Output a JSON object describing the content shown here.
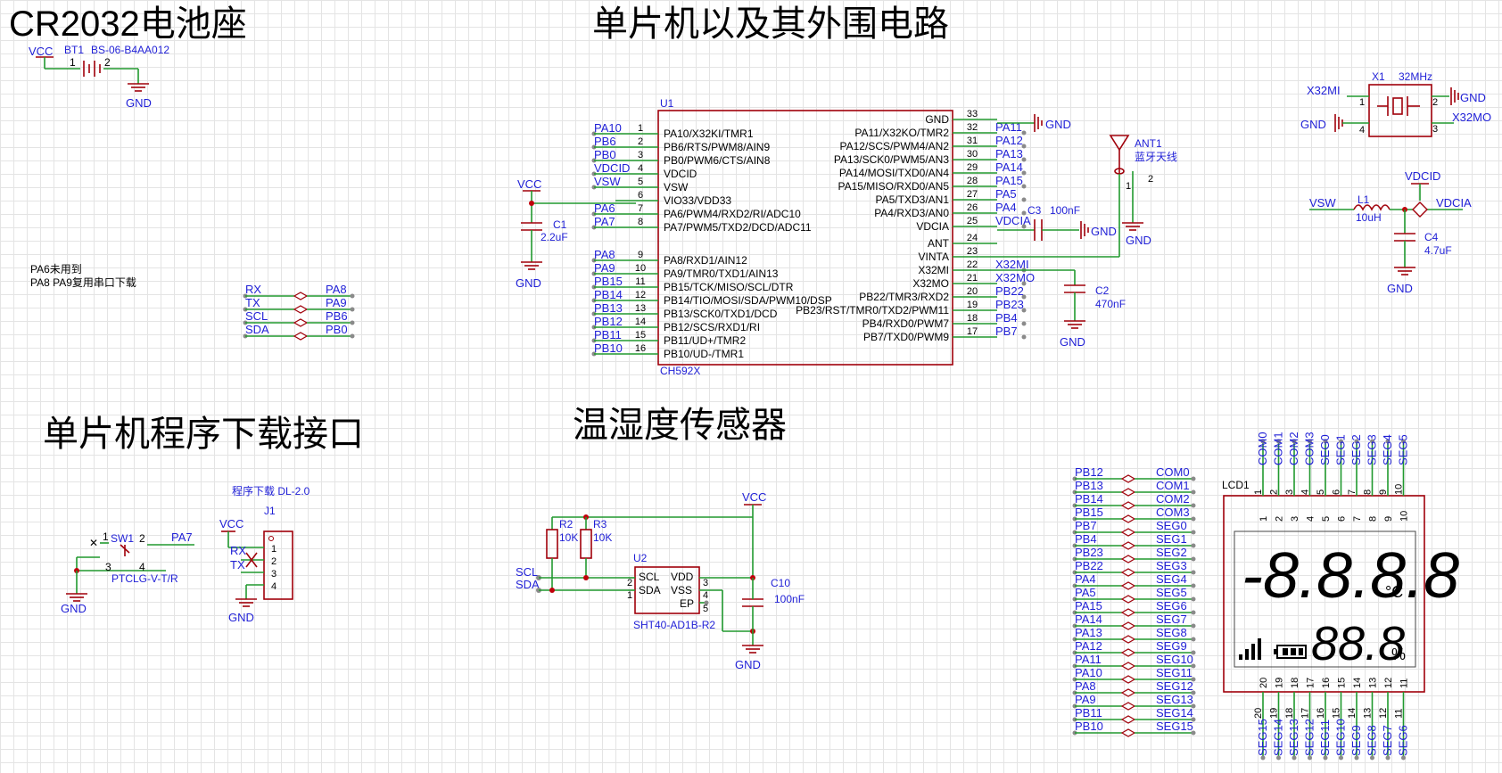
{
  "sections": {
    "battery": "CR2032电池座",
    "mcu": "单片机以及其外围电路",
    "download": "单片机程序下载接口",
    "sensor": "温湿度传感器"
  },
  "battery": {
    "vcc": "VCC",
    "ref": "BT1",
    "value": "BS-06-B4AA012",
    "pin1": "1",
    "pin2": "2",
    "gnd": "GND"
  },
  "notes": [
    "PA6未用到",
    "PA8 PA9复用串口下载"
  ],
  "uart_map": [
    {
      "a": "RX",
      "b": "PA8"
    },
    {
      "a": "TX",
      "b": "PA9"
    },
    {
      "a": "SCL",
      "b": "PB6"
    },
    {
      "a": "SDA",
      "b": "PB0"
    }
  ],
  "mcu": {
    "ref": "U1",
    "part": "CH592X",
    "left_pins": [
      {
        "num": "1",
        "name": "PA10/X32KI/TMR1",
        "net": "PA10"
      },
      {
        "num": "2",
        "name": "PB6/RTS/PWM8/AIN9",
        "net": "PB6"
      },
      {
        "num": "3",
        "name": "PB0/PWM6/CTS/AIN8",
        "net": "PB0"
      },
      {
        "num": "4",
        "name": "VDCID",
        "net": "VDCID"
      },
      {
        "num": "5",
        "name": "VSW",
        "net": "VSW"
      },
      {
        "num": "6",
        "name": "VIO33/VDD33",
        "net": ""
      },
      {
        "num": "7",
        "name": "PA6/PWM4/RXD2/RI/ADC10",
        "net": "PA6"
      },
      {
        "num": "8",
        "name": "PA7/PWM5/TXD2/DCD/ADC11",
        "net": "PA7"
      },
      {
        "num": "9",
        "name": "PA8/RXD1/AIN12",
        "net": "PA8"
      },
      {
        "num": "10",
        "name": "PA9/TMR0/TXD1/AIN13",
        "net": "PA9"
      },
      {
        "num": "11",
        "name": "PB15/TCK/MISO/SCL/DTR",
        "net": "PB15"
      },
      {
        "num": "12",
        "name": "PB14/TIO/MOSI/SDA/PWM10/DSP",
        "net": "PB14"
      },
      {
        "num": "13",
        "name": "PB13/SCK0/TXD1/DCD",
        "net": "PB13"
      },
      {
        "num": "14",
        "name": "PB12/SCS/RXD1/RI",
        "net": "PB12"
      },
      {
        "num": "15",
        "name": "PB11/UD+/TMR2",
        "net": "PB11"
      },
      {
        "num": "16",
        "name": "PB10/UD-/TMR1",
        "net": "PB10"
      }
    ],
    "right_pins": [
      {
        "num": "33",
        "name": "GND",
        "net": ""
      },
      {
        "num": "32",
        "name": "PA11/X32KO/TMR2",
        "net": "PA11"
      },
      {
        "num": "31",
        "name": "PA12/SCS/PWM4/AN2",
        "net": "PA12"
      },
      {
        "num": "30",
        "name": "PA13/SCK0/PWM5/AN3",
        "net": "PA13"
      },
      {
        "num": "29",
        "name": "PA14/MOSI/TXD0/AN4",
        "net": "PA14"
      },
      {
        "num": "28",
        "name": "PA15/MISO/RXD0/AN5",
        "net": "PA15"
      },
      {
        "num": "27",
        "name": "PA5/TXD3/AN1",
        "net": "PA5"
      },
      {
        "num": "26",
        "name": "PA4/RXD3/AN0",
        "net": "PA4"
      },
      {
        "num": "25",
        "name": "VDCIA",
        "net": "VDCIA"
      },
      {
        "num": "24",
        "name": "ANT",
        "net": ""
      },
      {
        "num": "23",
        "name": "VINTA",
        "net": ""
      },
      {
        "num": "22",
        "name": "X32MI",
        "net": "X32MI"
      },
      {
        "num": "21",
        "name": "X32MO",
        "net": "X32MO"
      },
      {
        "num": "20",
        "name": "PB22/TMR3/RXD2",
        "net": "PB22"
      },
      {
        "num": "19",
        "name": "PB23/RST/TMR0/TXD2/PWM11",
        "net": "PB23"
      },
      {
        "num": "18",
        "name": "PB4/RXD0/PWM7",
        "net": "PB4"
      },
      {
        "num": "17",
        "name": "PB7/TXD0/PWM9",
        "net": "PB7"
      }
    ],
    "gnd": "GND"
  },
  "mcu_periph": {
    "vcc": "VCC",
    "c1": {
      "ref": "C1",
      "value": "2.2uF"
    },
    "c3": {
      "ref": "C3",
      "value": "100nF"
    },
    "c2": {
      "ref": "C2",
      "value": "470nF"
    },
    "ant": {
      "ref": "ANT1",
      "value": "蓝牙天线",
      "pin1": "1",
      "pin2": "2"
    },
    "gnd": "GND"
  },
  "crystal": {
    "ref": "X1",
    "value": "32MHz",
    "net_mi": "X32MI",
    "net_mo": "X32MO",
    "gnd": "GND",
    "p1": "1",
    "p2": "2",
    "p3": "3",
    "p4": "4"
  },
  "inductor": {
    "vdcid": "VDCID",
    "vsw": "VSW",
    "ref": "L1",
    "value": "10uH",
    "vdcia": "VDCIA",
    "c4": {
      "ref": "C4",
      "value": "4.7uF"
    },
    "gnd": "GND"
  },
  "download_if": {
    "sw_ref": "SW1",
    "sw_part": "PTCLG-V-T/R",
    "sw_net": "PA7",
    "gnd": "GND",
    "sw_pins": [
      "1",
      "2",
      "3",
      "4"
    ],
    "j_title": "程序下载 DL-2.0",
    "j_ref": "J1",
    "vcc": "VCC",
    "rx": "RX",
    "tx": "TX",
    "j_pins": [
      "1",
      "2",
      "3",
      "4"
    ]
  },
  "sensor": {
    "vcc": "VCC",
    "r2": {
      "ref": "R2",
      "value": "10K"
    },
    "r3": {
      "ref": "R3",
      "value": "10K"
    },
    "u2": "U2",
    "part": "SHT40-AD1B-R2",
    "pin_scl": "SCL",
    "pin_sda": "SDA",
    "pin_vdd": "VDD",
    "pin_vss": "VSS",
    "pin_ep": "EP",
    "net_scl": "SCL",
    "net_sda": "SDA",
    "c10": {
      "ref": "C10",
      "value": "100nF"
    },
    "gnd": "GND",
    "pnums": [
      "2",
      "1",
      "3",
      "4",
      "5"
    ]
  },
  "lcd_map": [
    {
      "a": "PB12",
      "b": "COM0"
    },
    {
      "a": "PB13",
      "b": "COM1"
    },
    {
      "a": "PB14",
      "b": "COM2"
    },
    {
      "a": "PB15",
      "b": "COM3"
    },
    {
      "a": "PB7",
      "b": "SEG0"
    },
    {
      "a": "PB4",
      "b": "SEG1"
    },
    {
      "a": "PB23",
      "b": "SEG2"
    },
    {
      "a": "PB22",
      "b": "SEG3"
    },
    {
      "a": "PA4",
      "b": "SEG4"
    },
    {
      "a": "PA5",
      "b": "SEG5"
    },
    {
      "a": "PA15",
      "b": "SEG6"
    },
    {
      "a": "PA14",
      "b": "SEG7"
    },
    {
      "a": "PA13",
      "b": "SEG8"
    },
    {
      "a": "PA12",
      "b": "SEG9"
    },
    {
      "a": "PA11",
      "b": "SEG10"
    },
    {
      "a": "PA10",
      "b": "SEG11"
    },
    {
      "a": "PA8",
      "b": "SEG12"
    },
    {
      "a": "PA9",
      "b": "SEG13"
    },
    {
      "a": "PB11",
      "b": "SEG14"
    },
    {
      "a": "PB10",
      "b": "SEG15"
    }
  ],
  "lcd": {
    "ref": "LCD1",
    "top_nets": [
      "COM0",
      "COM1",
      "COM2",
      "COM3",
      "SEG0",
      "SEG1",
      "SEG2",
      "SEG3",
      "SEG4",
      "SEG5"
    ],
    "top_nums": [
      "1",
      "2",
      "3",
      "4",
      "5",
      "6",
      "7",
      "8",
      "9",
      "10"
    ],
    "bottom_nums": [
      "20",
      "19",
      "18",
      "17",
      "16",
      "15",
      "14",
      "13",
      "12",
      "11"
    ],
    "bottom_nets": [
      "SEG15",
      "SEG14",
      "SEG13",
      "SEG12",
      "SEG11",
      "SEG10",
      "SEG9",
      "SEG8",
      "SEG7",
      "SEG6"
    ],
    "temp": "-8.8.8.8",
    "temp_unit": "°C",
    "hum": "88.8",
    "hum_unit": "%"
  }
}
